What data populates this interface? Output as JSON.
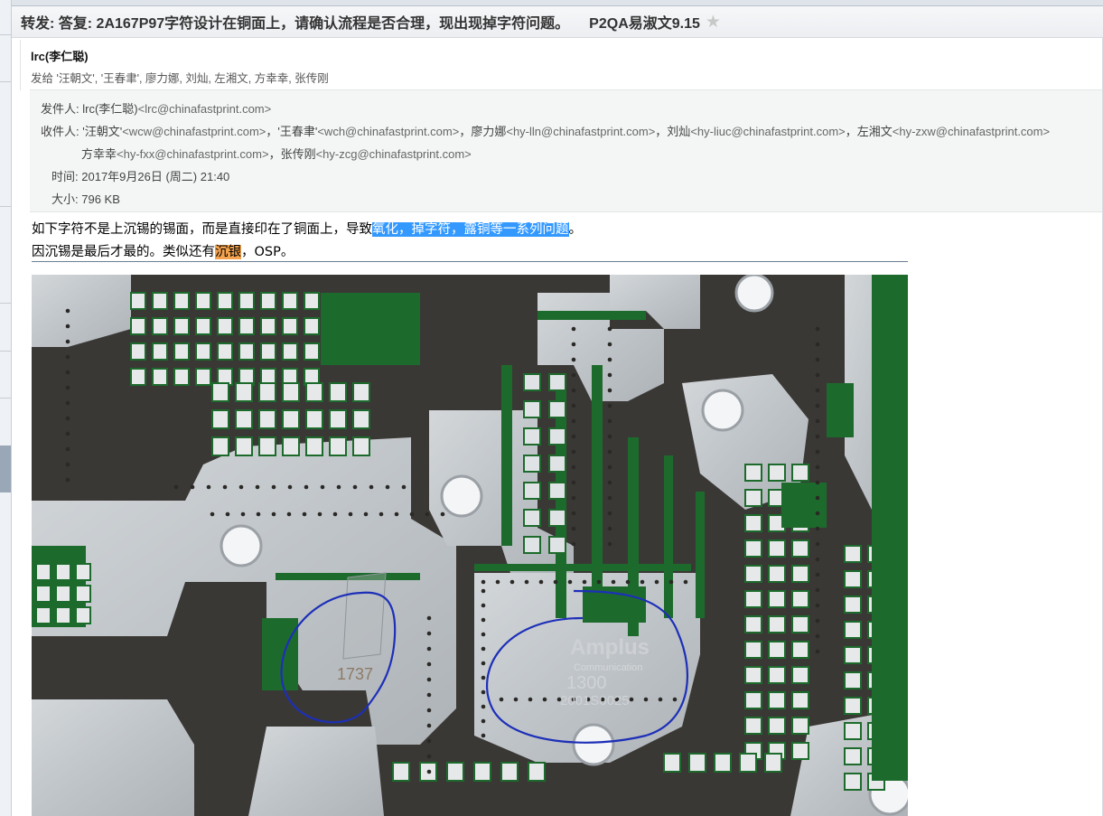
{
  "subject": {
    "title": "转发: 答复: 2A167P97字符设计在铜面上，请确认流程是否合理，现出现掉字符问题。",
    "tag": "P2QA易淑文9.15",
    "star_icon": "star-icon"
  },
  "sender": {
    "name": "lrc(李仁聪)",
    "sent_to": "发给 '汪朝文', '王春聿', 廖力娜, 刘灿, 左湘文, 方幸幸, 张传刚"
  },
  "header": {
    "from_label": "发件人:",
    "from_name": "lrc(李仁聪)",
    "from_addr": "<lrc@chinafastprint.com>",
    "to_label": "收件人:",
    "to_line1_parts": [
      {
        "name": "'汪朝文'",
        "addr": "<wcw@chinafastprint.com>"
      },
      {
        "name": "，'王春聿'",
        "addr": "<wch@chinafastprint.com>"
      },
      {
        "name": "，廖力娜",
        "addr": "<hy-lln@chinafastprint.com>"
      },
      {
        "name": "，刘灿",
        "addr": "<hy-liuc@chinafastprint.com>"
      },
      {
        "name": "，左湘文",
        "addr": "<hy-zxw@chinafastprint.com>"
      }
    ],
    "to_line2_parts": [
      {
        "name": "方幸幸",
        "addr": "<hy-fxx@chinafastprint.com>"
      },
      {
        "name": "，张传刚",
        "addr": "<hy-zcg@chinafastprint.com>"
      }
    ],
    "time_label": "时间:",
    "time_value": "2017年9月26日 (周二) 21:40",
    "size_label": "大小:",
    "size_value": "796 KB"
  },
  "body": {
    "line1_plain": "如下字符不是上沉锡的锡面，而是直接印在了铜面上，导致",
    "line1_highlight": "氧化，掉字符，露铜等一系列问题",
    "line1_end": "。",
    "line2_plain": "因沉锡是最后才最的。类似还有",
    "line2_highlight": "沉银",
    "line2_end": "，OSP。"
  },
  "photo": {
    "marking_left": "1737",
    "logo_text": "Amplus",
    "logo_sub": "Communication",
    "code_1": "1300",
    "code_2": "2001S0025",
    "colors": {
      "board": "#3c3a37",
      "copper": "#c4c9cd",
      "mask": "#1d6b2c",
      "circle": "#1d2fb8"
    }
  }
}
